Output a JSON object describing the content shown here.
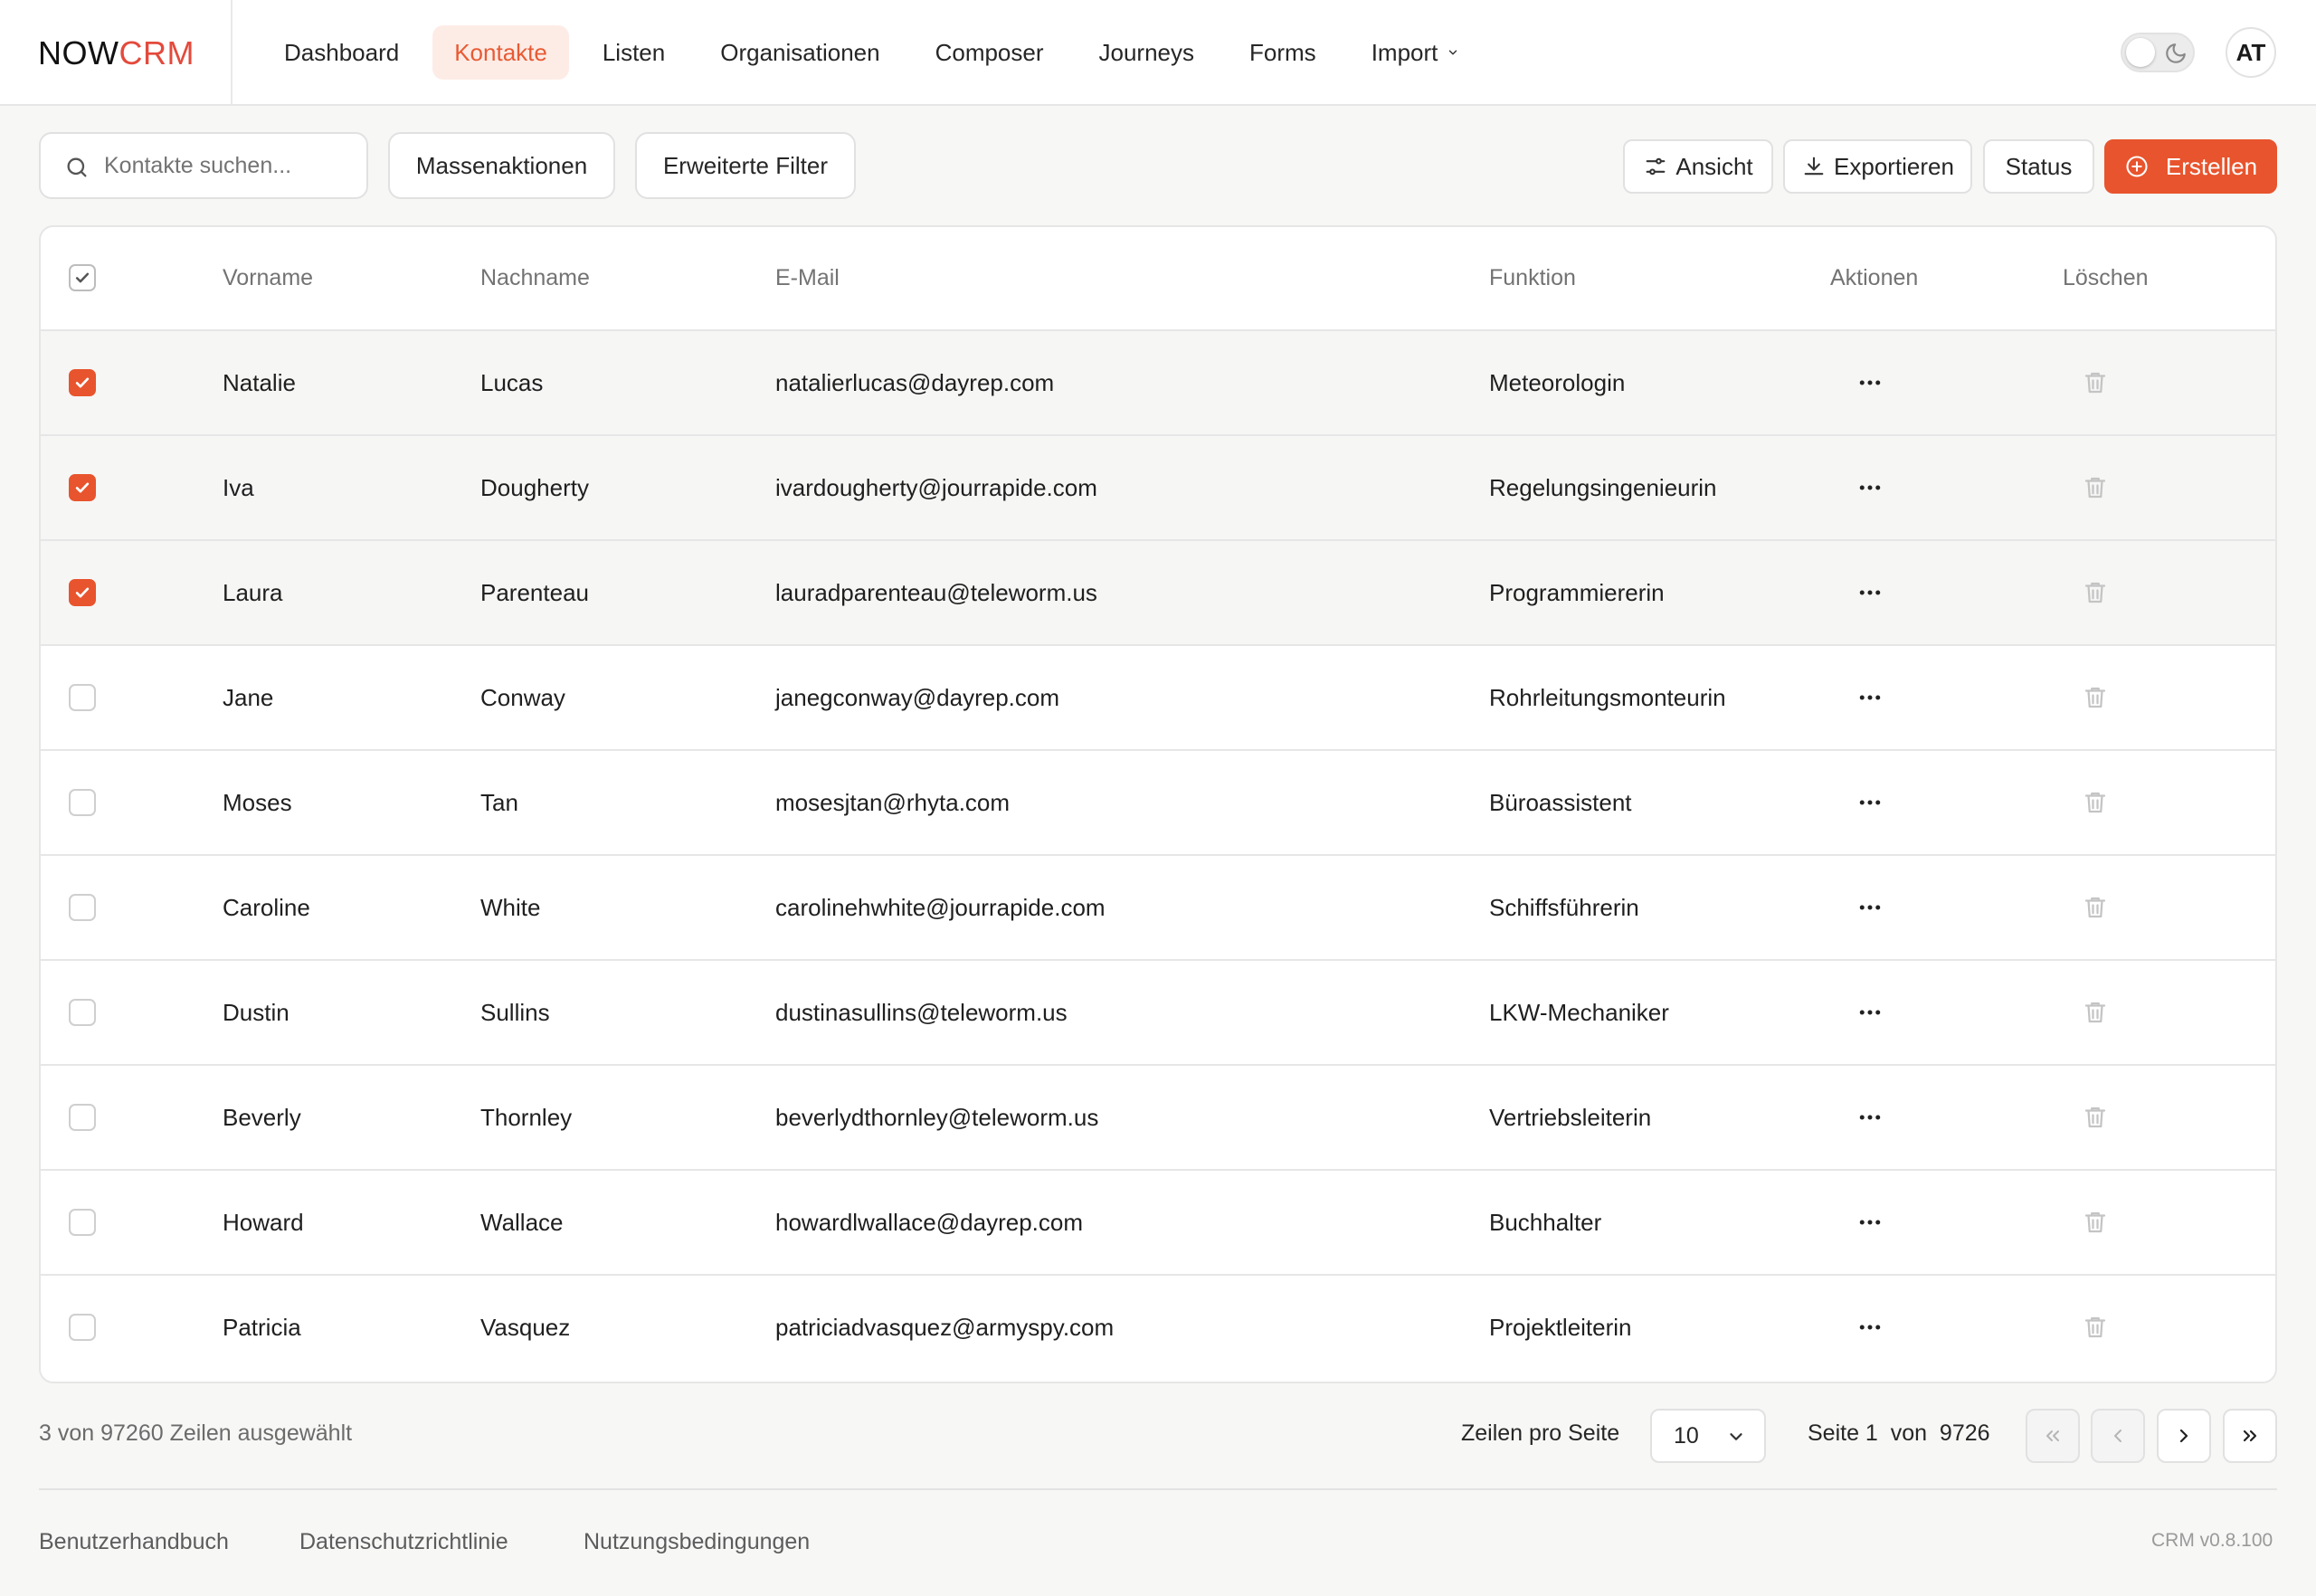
{
  "app": {
    "logo_part1": "NOW",
    "logo_part2": "CRM"
  },
  "nav": {
    "items": [
      {
        "label": "Dashboard"
      },
      {
        "label": "Kontakte",
        "active": true
      },
      {
        "label": "Listen"
      },
      {
        "label": "Organisationen"
      },
      {
        "label": "Composer"
      },
      {
        "label": "Journeys"
      },
      {
        "label": "Forms"
      },
      {
        "label": "Import",
        "has_dropdown": true,
        "icon": "chevron-down-icon"
      }
    ]
  },
  "header": {
    "theme_toggle_icon": "moon-icon",
    "avatar_initials": "AT"
  },
  "toolbar": {
    "search_placeholder": "Kontakte suchen...",
    "search_value": "",
    "bulk_actions_label": "Massenaktionen",
    "advanced_filter_label": "Erweiterte Filter",
    "view_label": "Ansicht",
    "export_label": "Exportieren",
    "status_label": "Status",
    "create_label": "Erstellen"
  },
  "table": {
    "header_checkbox_checked": true,
    "columns": [
      "Vorname",
      "Nachname",
      "E-Mail",
      "Funktion",
      "Aktionen",
      "Löschen"
    ],
    "rows": [
      {
        "checked": true,
        "first_name": "Natalie",
        "last_name": "Lucas",
        "email": "natalierlucas@dayrep.com",
        "function": "Meteorologin"
      },
      {
        "checked": true,
        "first_name": "Iva",
        "last_name": "Dougherty",
        "email": "ivardougherty@jourrapide.com",
        "function": "Regelungsingenieurin"
      },
      {
        "checked": true,
        "first_name": "Laura",
        "last_name": "Parenteau",
        "email": "lauradparenteau@teleworm.us",
        "function": "Programmiererin"
      },
      {
        "checked": false,
        "first_name": "Jane",
        "last_name": "Conway",
        "email": "janegconway@dayrep.com",
        "function": "Rohrleitungsmonteurin"
      },
      {
        "checked": false,
        "first_name": "Moses",
        "last_name": "Tan",
        "email": "mosesjtan@rhyta.com",
        "function": "Büroassistent"
      },
      {
        "checked": false,
        "first_name": "Caroline",
        "last_name": "White",
        "email": "carolinehwhite@jourrapide.com",
        "function": "Schiffsführerin"
      },
      {
        "checked": false,
        "first_name": "Dustin",
        "last_name": "Sullins",
        "email": "dustinasullins@teleworm.us",
        "function": "LKW-Mechaniker"
      },
      {
        "checked": false,
        "first_name": "Beverly",
        "last_name": "Thornley",
        "email": "beverlydthornley@teleworm.us",
        "function": "Vertriebsleiterin"
      },
      {
        "checked": false,
        "first_name": "Howard",
        "last_name": "Wallace",
        "email": "howardlwallace@dayrep.com",
        "function": "Buchhalter"
      },
      {
        "checked": false,
        "first_name": "Patricia",
        "last_name": "Vasquez",
        "email": "patriciadvasquez@armyspy.com",
        "function": "Projektleiterin"
      }
    ]
  },
  "pagination": {
    "selected_text": "3 von 97260 Zeilen ausgewählt",
    "rows_per_page_label": "Zeilen pro Seite",
    "rows_per_page_value": "10",
    "page_text": "Seite 1  von  9726"
  },
  "footer": {
    "links": [
      "Benutzerhandbuch",
      "Datenschutzrichtlinie",
      "Nutzungsbedingungen"
    ],
    "version": "CRM v0.8.100"
  },
  "colors": {
    "accent": "#e8542d",
    "logo_accent": "#e34a3c",
    "active_nav_bg": "#fdece6"
  }
}
